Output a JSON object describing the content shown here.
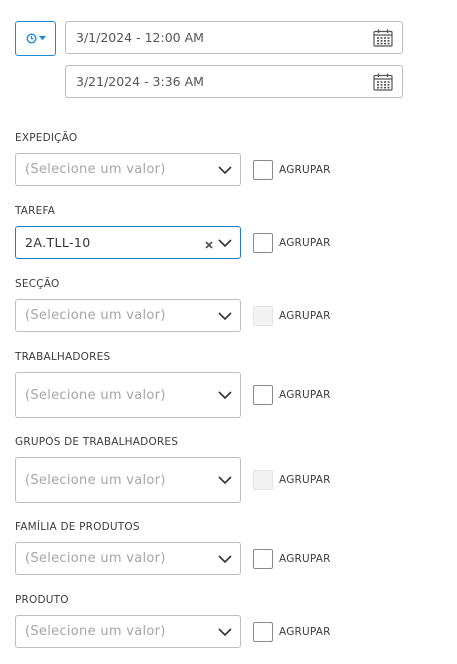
{
  "date_range": {
    "time_button_icon": "clock-icon",
    "start": "3/1/2024 - 12:00 AM",
    "end": "3/21/2024 - 3:36 AM",
    "calendar_icon": "calendar-icon"
  },
  "filters": {
    "group_label": "AGRUPAR",
    "expedicao": {
      "label": "EXPEDIÇÃO",
      "placeholder": "(Selecione um valor)"
    },
    "tarefa": {
      "label": "TAREFA",
      "value": "2A.TLL-10"
    },
    "seccao": {
      "label": "SECÇÃO",
      "placeholder": "(Selecione um valor)"
    },
    "trabalhadores": {
      "label": "TRABALHADORES",
      "placeholder": "(Selecione um valor)"
    },
    "grupos": {
      "label": "GRUPOS DE TRABALHADORES",
      "placeholder": "(Selecione um valor)"
    },
    "familia": {
      "label": "FAMÍLIA DE PRODUTOS",
      "placeholder": "(Selecione um valor)"
    },
    "produto": {
      "label": "PRODUTO",
      "placeholder": "(Selecione um valor)"
    }
  },
  "colors": {
    "accent": "#1f8ad6",
    "border": "#bdbdbd",
    "placeholder": "#a5a5a5"
  }
}
